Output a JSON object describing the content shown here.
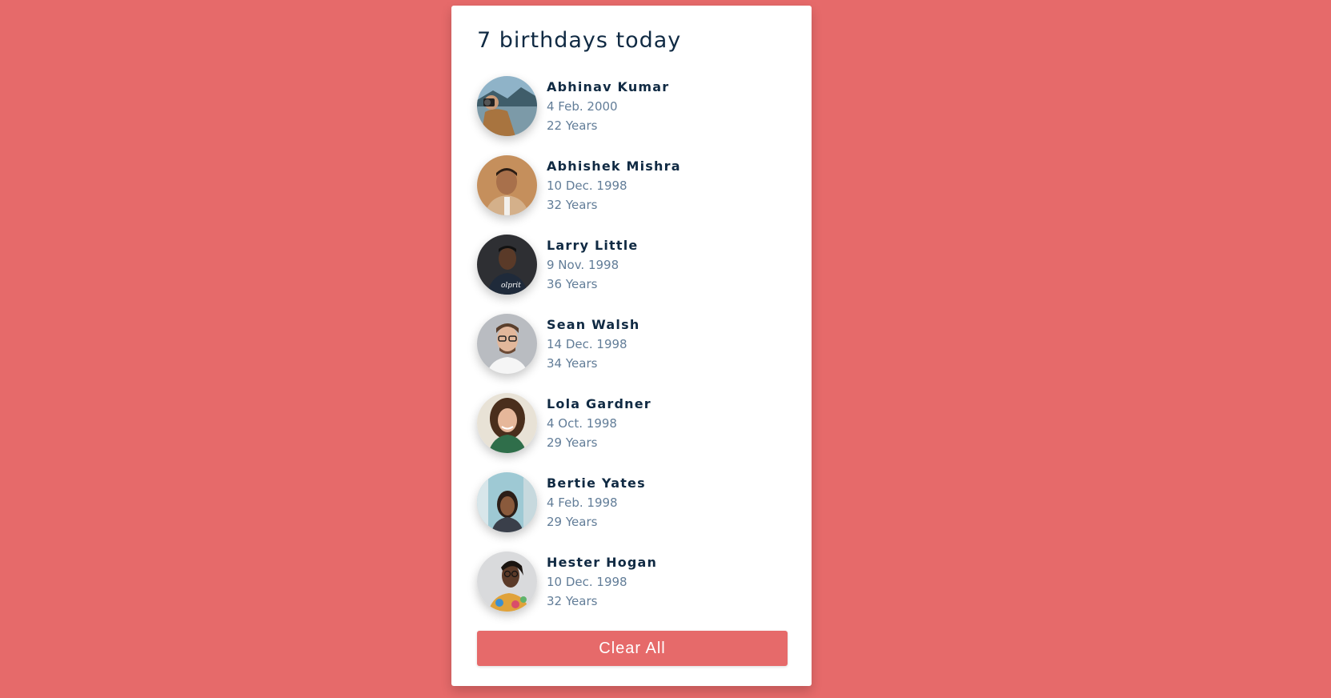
{
  "header": {
    "title": "7 birthdays today"
  },
  "people": [
    {
      "name": "Abhinav Kumar",
      "date": "4 Feb. 2000",
      "age": "22 Years",
      "avatar": "photo-camera-lake"
    },
    {
      "name": "Abhishek Mishra",
      "date": "10 Dec. 1998",
      "age": "32 Years",
      "avatar": "photo-man-beige"
    },
    {
      "name": "Larry Little",
      "date": "9 Nov. 1998",
      "age": "36 Years",
      "avatar": "photo-man-dark"
    },
    {
      "name": "Sean Walsh",
      "date": "14 Dec. 1998",
      "age": "34 Years",
      "avatar": "photo-man-glasses"
    },
    {
      "name": "Lola Gardner",
      "date": "4 Oct. 1998",
      "age": "29 Years",
      "avatar": "photo-woman-curly"
    },
    {
      "name": "Bertie Yates",
      "date": "4 Feb. 1998",
      "age": "29 Years",
      "avatar": "photo-woman-city"
    },
    {
      "name": "Hester Hogan",
      "date": "10 Dec. 1998",
      "age": "32 Years",
      "avatar": "photo-woman-colorful"
    }
  ],
  "actions": {
    "clear_label": "Clear All"
  },
  "colors": {
    "background": "#e66a6a",
    "button": "#e66a6a",
    "name": "#102a43",
    "meta": "#627d98"
  }
}
